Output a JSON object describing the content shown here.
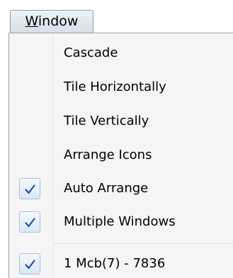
{
  "menubar": {
    "window_label_mnemonic": "W",
    "window_label_rest": "indow"
  },
  "menu": {
    "items": [
      {
        "label": "Cascade",
        "checked": false
      },
      {
        "label": "Tile Horizontally",
        "checked": false
      },
      {
        "label": "Tile Vertically",
        "checked": false
      },
      {
        "label": "Arrange Icons",
        "checked": false
      },
      {
        "label": "Auto Arrange",
        "checked": true
      },
      {
        "label": "Multiple Windows",
        "checked": true
      },
      {
        "label": "1 Mcb(7) - 7836",
        "checked": true
      }
    ],
    "check_icon": "checkmark-icon",
    "check_color": "#1e4fb8"
  }
}
